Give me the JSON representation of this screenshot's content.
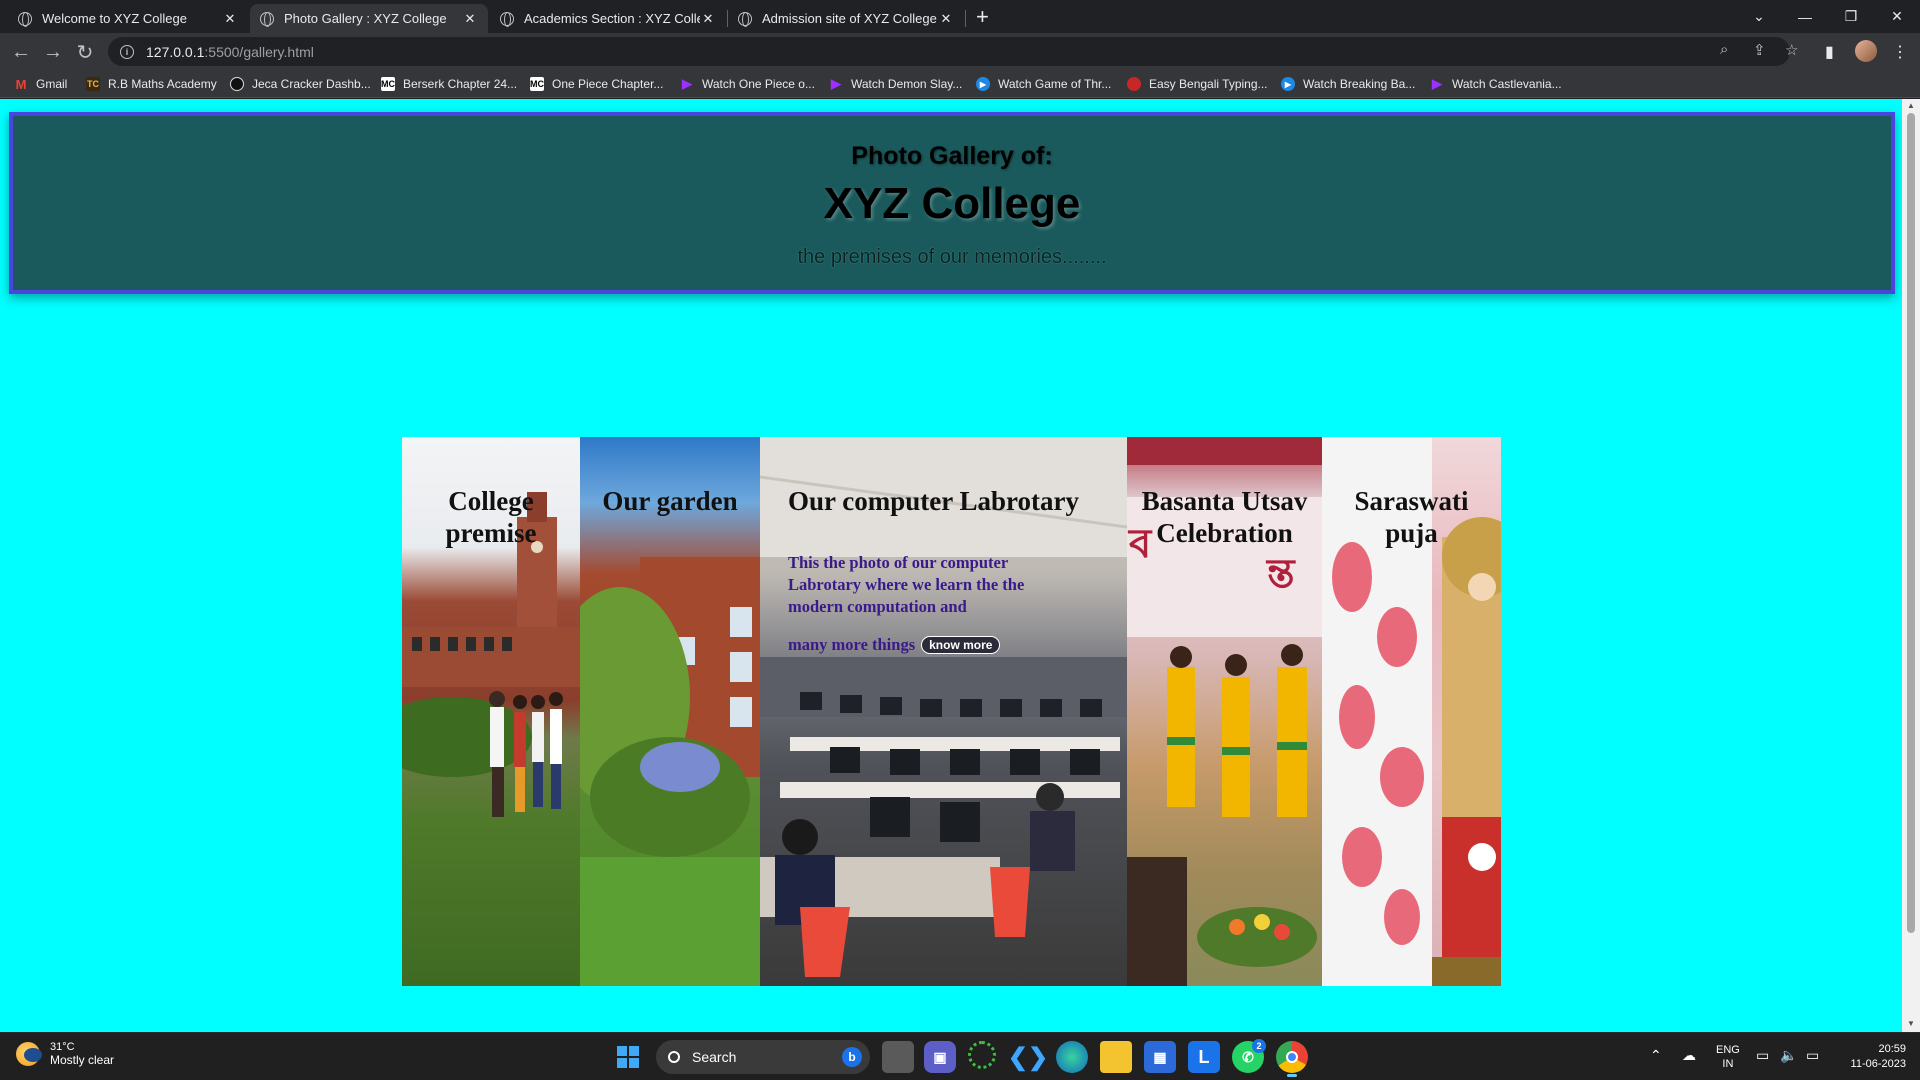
{
  "browser": {
    "tabs": [
      {
        "title": "Welcome to XYZ College",
        "active": false
      },
      {
        "title": "Photo Gallery : XYZ College",
        "active": true
      },
      {
        "title": "Academics Section : XYZ College",
        "active": false
      },
      {
        "title": "Admission site of XYZ College",
        "active": false
      }
    ],
    "url_host": "127.0.0.1",
    "url_path": ":5500/gallery.html",
    "bookmarks": [
      {
        "label": "Gmail",
        "icon": "gmail-icon"
      },
      {
        "label": "R.B Maths Academy",
        "icon": "rb-icon"
      },
      {
        "label": "Jeca Cracker Dashb...",
        "icon": "jeca-icon"
      },
      {
        "label": "Berserk Chapter 24...",
        "icon": "mc-icon"
      },
      {
        "label": "One Piece Chapter...",
        "icon": "mc-icon"
      },
      {
        "label": "Watch One Piece o...",
        "icon": "play-icon"
      },
      {
        "label": "Watch Demon Slay...",
        "icon": "play-icon"
      },
      {
        "label": "Watch Game of Thr...",
        "icon": "circle-play-icon"
      },
      {
        "label": "Easy Bengali Typing...",
        "icon": "bengali-icon"
      },
      {
        "label": "Watch Breaking Ba...",
        "icon": "circle-play-icon"
      },
      {
        "label": "Watch Castlevania...",
        "icon": "play-icon"
      }
    ]
  },
  "header": {
    "subtitle": "Photo Gallery of:",
    "title": "XYZ College",
    "tagline": "the premises of our memories........"
  },
  "gallery": {
    "panels": [
      {
        "caption": "College premise"
      },
      {
        "caption": "Our garden"
      },
      {
        "caption": "Our computer Labrotary",
        "description": "This the photo of our computer Labrotary where we learn the the modern computation and",
        "description_last": "many more things",
        "button": "know more"
      },
      {
        "caption": "Basanta Utsav Celebration"
      },
      {
        "caption": "Saraswati puja"
      }
    ]
  },
  "taskbar": {
    "weather_temp": "31°C",
    "weather_cond": "Mostly clear",
    "search_label": "Search",
    "lang_top": "ENG",
    "lang_bottom": "IN",
    "time": "20:59",
    "date": "11-06-2023",
    "whatsapp_badge": "2"
  }
}
